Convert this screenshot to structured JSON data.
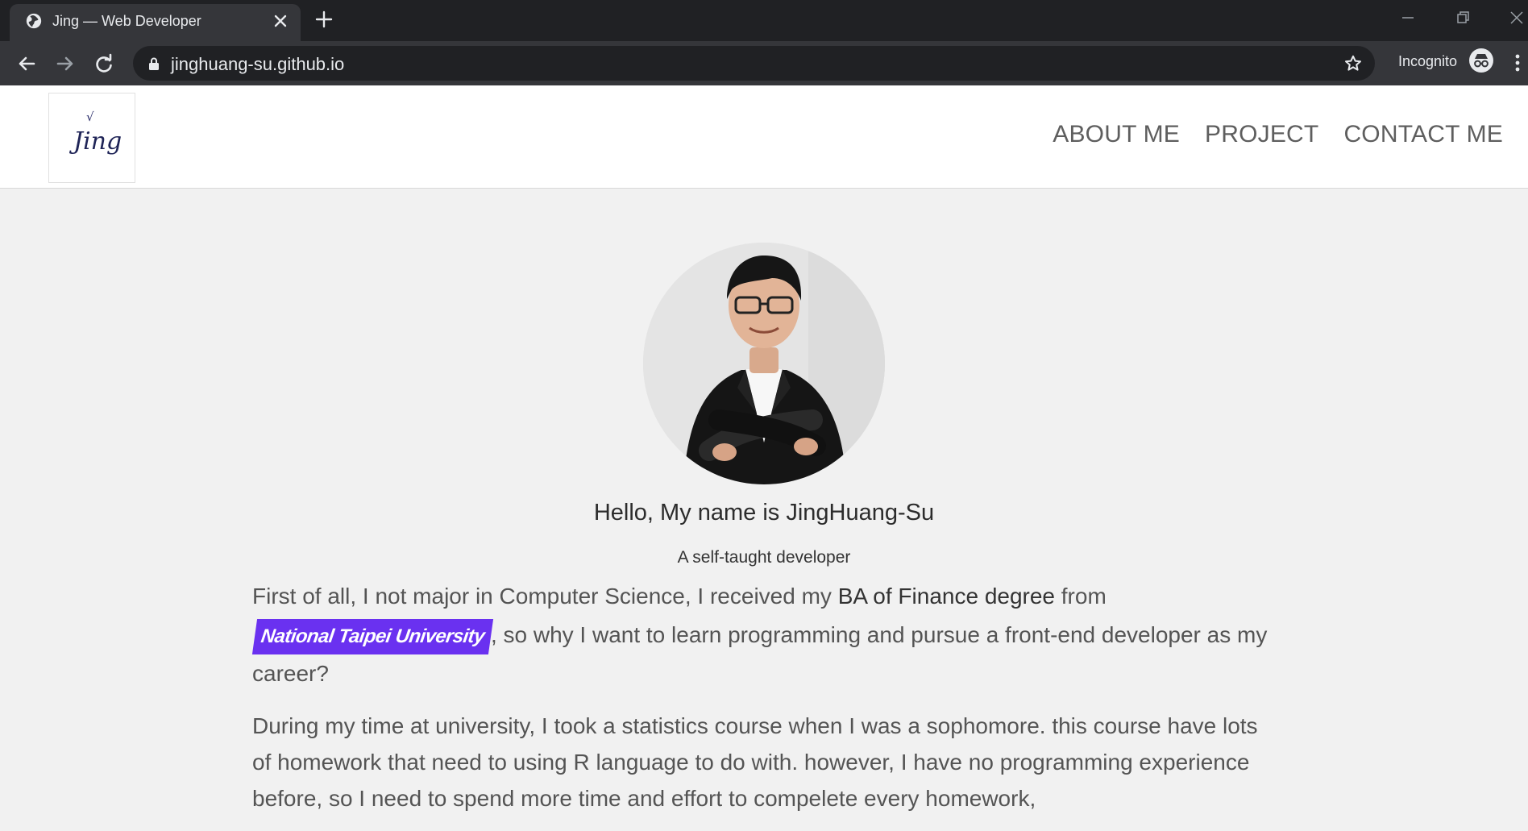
{
  "browser": {
    "tab_title": "Jing — Web Developer",
    "url": "jinghuang-su.github.io",
    "profile_label": "Incognito",
    "icons": {
      "tab_site": "globe-icon",
      "close": "close-icon",
      "new_tab": "plus-icon",
      "back": "back-arrow-icon",
      "forward": "forward-arrow-icon",
      "reload": "reload-icon",
      "lock": "lock-icon",
      "bookmark": "star-icon",
      "incognito": "incognito-icon",
      "menu": "kebab-menu-icon"
    }
  },
  "site": {
    "logo_text": "Jing",
    "nav": [
      "ABOUT ME",
      "PROJECT",
      "CONTACT ME"
    ]
  },
  "hero": {
    "title": "Hello, My name is JingHuang-Su",
    "subtitle": "A self-taught developer"
  },
  "bio": {
    "p1_part1": "First of all, I not major in Computer Science, I received my ",
    "p1_emph": "BA of Finance degree",
    "p1_part2": " from",
    "p1_highlight": "National Taipei University",
    "p1_part3": ", so why I want to learn programming and pursue a front-end developer as my career?",
    "p2": "During my time at university, I took a statistics course when I was a sophomore. this course have lots of homework that need to using R language to do with. however, I have no programming experience before, so I need to spend more time and effort to compelete every homework,"
  },
  "colors": {
    "accent": "#6a31f0",
    "page_bg": "#f1f1f1",
    "nav_text": "#5e5e5e"
  }
}
